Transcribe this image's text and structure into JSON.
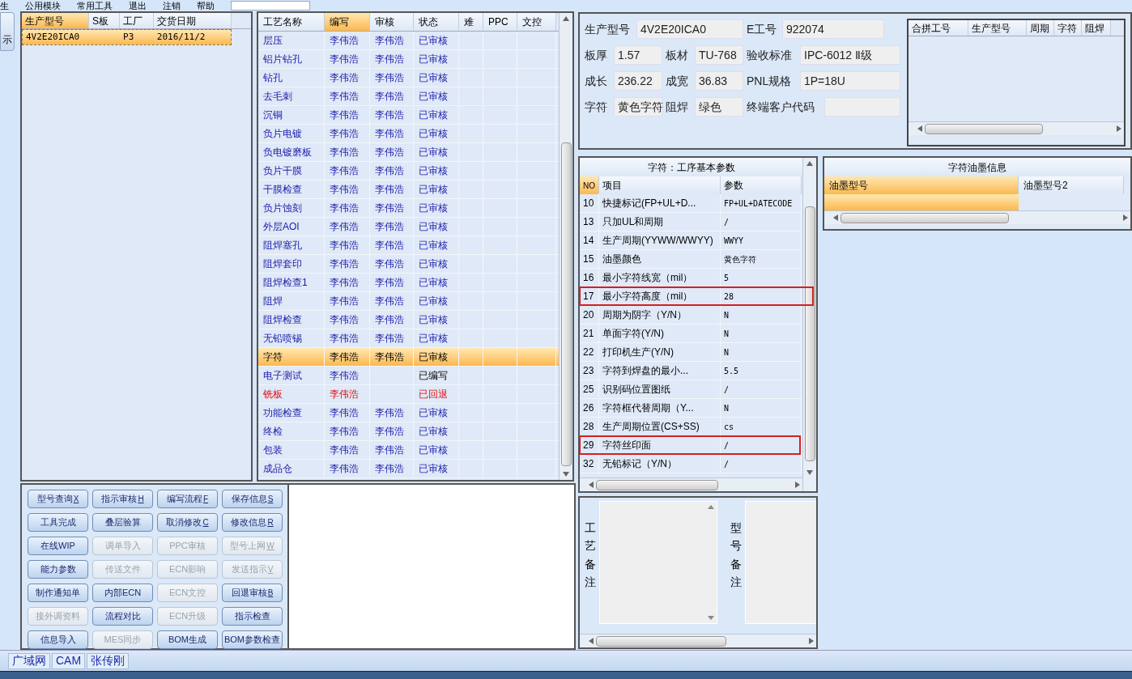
{
  "menu": [
    "生",
    "公用模块",
    "常用工具",
    "退出",
    "注销",
    "帮助"
  ],
  "left_strip": {
    "button": "示"
  },
  "models": {
    "columns": [
      {
        "label": "生产型号",
        "sorted": true
      },
      {
        "label": "S板",
        "sorted": false
      },
      {
        "label": "工厂",
        "sorted": false
      },
      {
        "label": "交货日期",
        "sorted": false
      }
    ],
    "rows": [
      {
        "cells": [
          "4V2E20ICA0",
          "",
          "P3",
          "2016/11/2"
        ],
        "selected": true
      }
    ]
  },
  "process": {
    "columns": [
      {
        "label": "工艺名称",
        "sorted": false
      },
      {
        "label": "编写",
        "sorted": true
      },
      {
        "label": "审核",
        "sorted": false
      },
      {
        "label": "状态",
        "sorted": false
      },
      {
        "label": "难",
        "sorted": false
      },
      {
        "label": "PPC",
        "sorted": false
      },
      {
        "label": "文控",
        "sorted": false
      }
    ],
    "rows": [
      {
        "name": "层压",
        "writer": "李伟浩",
        "reviewer": "李伟浩",
        "status": "已审核",
        "selected": false,
        "returned": false
      },
      {
        "name": "铝片钻孔",
        "writer": "李伟浩",
        "reviewer": "李伟浩",
        "status": "已审核",
        "selected": false,
        "returned": false
      },
      {
        "name": "钻孔",
        "writer": "李伟浩",
        "reviewer": "李伟浩",
        "status": "已审核",
        "selected": false,
        "returned": false
      },
      {
        "name": "去毛刺",
        "writer": "李伟浩",
        "reviewer": "李伟浩",
        "status": "已审核",
        "selected": false,
        "returned": false
      },
      {
        "name": "沉铜",
        "writer": "李伟浩",
        "reviewer": "李伟浩",
        "status": "已审核",
        "selected": false,
        "returned": false
      },
      {
        "name": "负片电镀",
        "writer": "李伟浩",
        "reviewer": "李伟浩",
        "status": "已审核",
        "selected": false,
        "returned": false
      },
      {
        "name": "负电镀磨板",
        "writer": "李伟浩",
        "reviewer": "李伟浩",
        "status": "已审核",
        "selected": false,
        "returned": false
      },
      {
        "name": "负片干膜",
        "writer": "李伟浩",
        "reviewer": "李伟浩",
        "status": "已审核",
        "selected": false,
        "returned": false
      },
      {
        "name": "干膜检查",
        "writer": "李伟浩",
        "reviewer": "李伟浩",
        "status": "已审核",
        "selected": false,
        "returned": false
      },
      {
        "name": "负片蚀刻",
        "writer": "李伟浩",
        "reviewer": "李伟浩",
        "status": "已审核",
        "selected": false,
        "returned": false
      },
      {
        "name": "外层AOI",
        "writer": "李伟浩",
        "reviewer": "李伟浩",
        "status": "已审核",
        "selected": false,
        "returned": false
      },
      {
        "name": "阻焊塞孔",
        "writer": "李伟浩",
        "reviewer": "李伟浩",
        "status": "已审核",
        "selected": false,
        "returned": false
      },
      {
        "name": "阻焊套印",
        "writer": "李伟浩",
        "reviewer": "李伟浩",
        "status": "已审核",
        "selected": false,
        "returned": false
      },
      {
        "name": "阻焊检查1",
        "writer": "李伟浩",
        "reviewer": "李伟浩",
        "status": "已审核",
        "selected": false,
        "returned": false
      },
      {
        "name": "阻焊",
        "writer": "李伟浩",
        "reviewer": "李伟浩",
        "status": "已审核",
        "selected": false,
        "returned": false
      },
      {
        "name": "阻焊检查",
        "writer": "李伟浩",
        "reviewer": "李伟浩",
        "status": "已审核",
        "selected": false,
        "returned": false
      },
      {
        "name": "无铅喷锡",
        "writer": "李伟浩",
        "reviewer": "李伟浩",
        "status": "已审核",
        "selected": false,
        "returned": false
      },
      {
        "name": "字符",
        "writer": "李伟浩",
        "reviewer": "李伟浩",
        "status": "已审核",
        "selected": true,
        "returned": false
      },
      {
        "name": "电子测试",
        "writer": "李伟浩",
        "status": "已编写",
        "selected": false,
        "returned": false
      },
      {
        "name": "铣板",
        "writer": "李伟浩",
        "status": "已回退",
        "selected": false,
        "returned": true
      },
      {
        "name": "功能检查",
        "writer": "李伟浩",
        "reviewer": "李伟浩",
        "status": "已审核",
        "selected": false,
        "returned": false
      },
      {
        "name": "终检",
        "writer": "李伟浩",
        "reviewer": "李伟浩",
        "status": "已审核",
        "selected": false,
        "returned": false
      },
      {
        "name": "包装",
        "writer": "李伟浩",
        "reviewer": "李伟浩",
        "status": "已审核",
        "selected": false,
        "returned": false
      },
      {
        "name": "成品仓",
        "writer": "李伟浩",
        "reviewer": "李伟浩",
        "status": "已审核",
        "selected": false,
        "returned": false
      }
    ]
  },
  "buttons": [
    {
      "label": "型号查询",
      "hotkey": "X",
      "disabled": false
    },
    {
      "label": "指示审核",
      "hotkey": "H",
      "disabled": false
    },
    {
      "label": "编写流程",
      "hotkey": "F",
      "disabled": false
    },
    {
      "label": "保存信息",
      "hotkey": "S",
      "disabled": false
    },
    {
      "label": "工具完成",
      "disabled": false
    },
    {
      "label": "叠层验算",
      "disabled": false
    },
    {
      "label": "取消修改",
      "hotkey": "C",
      "disabled": false
    },
    {
      "label": "修改信息",
      "hotkey": "R",
      "disabled": false
    },
    {
      "label": "在线WIP",
      "disabled": false
    },
    {
      "label": "调单导入",
      "disabled": true
    },
    {
      "label": "PPC审核",
      "disabled": true
    },
    {
      "label": "型号上网",
      "hotkey": "W",
      "disabled": true
    },
    {
      "label": "能力参数",
      "disabled": false
    },
    {
      "label": "传送文件",
      "disabled": true
    },
    {
      "label": "ECN影响",
      "disabled": true
    },
    {
      "label": "发送指示",
      "hotkey": "V",
      "disabled": true
    },
    {
      "label": "制作通知单",
      "disabled": false
    },
    {
      "label": "内部ECN",
      "disabled": false
    },
    {
      "label": "ECN文控",
      "disabled": true
    },
    {
      "label": "回退审核",
      "hotkey": "B",
      "disabled": false
    },
    {
      "label": "接外调资料",
      "disabled": true
    },
    {
      "label": "流程对比",
      "disabled": false
    },
    {
      "label": "ECN升级",
      "disabled": true
    },
    {
      "label": "指示检查",
      "disabled": false
    },
    {
      "label": "信息导入",
      "disabled": false
    },
    {
      "label": "MES同步",
      "disabled": true
    },
    {
      "label": "BOM生成",
      "disabled": false
    },
    {
      "label": "BOM参数检查",
      "disabled": false
    }
  ],
  "info_form": [
    [
      {
        "label": "生产型号",
        "value": "4V2E20ICA0"
      },
      {
        "label": "E工号",
        "value": "922074"
      }
    ],
    [
      {
        "label": "板厚",
        "value": "1.57"
      },
      {
        "label": "板材",
        "value": "TU-768"
      },
      {
        "label": "验收标准",
        "value": "IPC-6012 Ⅱ级"
      }
    ],
    [
      {
        "label": "成长",
        "value": "236.22"
      },
      {
        "label": "成宽",
        "value": "36.83"
      },
      {
        "label": "PNL规格",
        "value": "1P=18U"
      }
    ],
    [
      {
        "label": "字符",
        "value": "黄色字符"
      },
      {
        "label": "阻焊",
        "value": "绿色"
      },
      {
        "label": "终端客户代码"
      }
    ]
  ],
  "merge_table": {
    "columns": [
      "合拼工号",
      "生产型号",
      "周期",
      "字符",
      "阻焊"
    ]
  },
  "params": {
    "title": "字符：工序基本参数",
    "columns": [
      {
        "label": "NO",
        "sorted": true
      },
      {
        "label": "项目",
        "sorted": false
      },
      {
        "label": "参数",
        "sorted": false
      }
    ],
    "rows": [
      {
        "no": "10",
        "item": "快捷标记(FP+UL+D...",
        "value": "FP+UL+DATECODE",
        "flagged": false
      },
      {
        "no": "13",
        "item": "只加UL和周期",
        "value": "/",
        "flagged": false
      },
      {
        "no": "14",
        "item": "生产周期(YYWW/WWYY)",
        "value": "WWYY",
        "flagged": false
      },
      {
        "no": "15",
        "item": "油墨颜色",
        "value": "黄色字符",
        "flagged": false
      },
      {
        "no": "16",
        "item": "最小字符线宽（mil）",
        "value": "5",
        "flagged": false
      },
      {
        "no": "17",
        "item": "最小字符高度（mil）",
        "value": "28",
        "flagged": true
      },
      {
        "no": "20",
        "item": "周期为阴字（Y/N）",
        "value": "N",
        "flagged": false
      },
      {
        "no": "21",
        "item": "单面字符(Y/N)",
        "value": "N",
        "flagged": false
      },
      {
        "no": "22",
        "item": "打印机生产(Y/N)",
        "value": "N",
        "flagged": false
      },
      {
        "no": "23",
        "item": "字符到焊盘的最小...",
        "value": "5.5",
        "flagged": false
      },
      {
        "no": "25",
        "item": "识别码位置图纸",
        "value": "/",
        "flagged": false
      },
      {
        "no": "26",
        "item": "字符框代替周期（Y...",
        "value": "N",
        "flagged": false
      },
      {
        "no": "28",
        "item": "生产周期位置(CS+SS)",
        "value": "cs",
        "flagged": false
      },
      {
        "no": "29",
        "item": "字符丝印面",
        "value": "/",
        "flagged": true
      },
      {
        "no": "32",
        "item": "无铅标记（Y/N）",
        "value": "/",
        "flagged": false
      }
    ]
  },
  "ink": {
    "title": "字符油墨信息",
    "columns": [
      {
        "label": "油墨型号",
        "sorted": true
      },
      {
        "label": "油墨型号2",
        "sorted": false
      }
    ],
    "rows": [
      {
        "selected": true
      }
    ]
  },
  "notes": [
    "工艺备注",
    "型号备注"
  ],
  "status_tabs": [
    "广域网",
    "CAM",
    "张传刚"
  ]
}
